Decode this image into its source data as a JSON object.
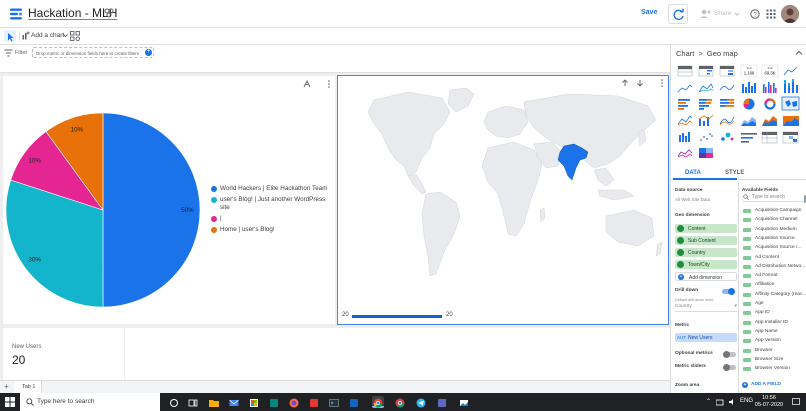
{
  "header": {
    "title": "Hackation - MLH",
    "save_label": "Save",
    "share_label": "Share"
  },
  "toolbar": {
    "add_chart_label": "Add a chart"
  },
  "filter_bar": {
    "label": "Filter",
    "drop_hint": "Drop metric or dimension fields here to create filters"
  },
  "pie_chart": {
    "chart_data": {
      "type": "pie",
      "slices": [
        {
          "label": "World Hackers | Elite Hackathon Team",
          "value": 50,
          "display": "50%",
          "color": "#1a73e8"
        },
        {
          "label": "user's Blog! | Just another WordPress site",
          "value": 30,
          "display": "30%",
          "color": "#12b5cb"
        },
        {
          "label": "|",
          "value": 10,
          "display": "10%",
          "color": "#e52592"
        },
        {
          "label": "Home | user's Blog!",
          "value": 10,
          "display": "10%",
          "color": "#e8710a"
        }
      ]
    }
  },
  "geo_map": {
    "highlighted_region": "India",
    "range_min": "20",
    "range_max": "20",
    "highlight_color": "#1a73e8"
  },
  "scorecard": {
    "label": "New Users",
    "value": "20"
  },
  "pages": [
    {
      "label": "Tab 1"
    }
  ],
  "panel": {
    "breadcrumb_root": "Chart",
    "breadcrumb_sep": ">",
    "breadcrumb_current": "Geo map",
    "tabs": [
      "DATA",
      "STYLE"
    ],
    "scorecard_thumb_values": [
      "1,168",
      "69.3K"
    ],
    "data_source_label": "Data source",
    "data_source_value": "All Web Site Data",
    "geo_dimension_label": "Geo dimension",
    "geo_dimensions": [
      "Content",
      "Sub Content",
      "Country",
      "Town/City"
    ],
    "add_dimension_label": "Add dimension",
    "drill_down_label": "Drill down",
    "drill_down_sub": "Default drill down level",
    "drill_down_value": "Country",
    "metric_label": "Metric",
    "metric_tag": "AUT",
    "metric_value": "New Users",
    "optional_metrics_label": "Optional metrics",
    "metric_sliders_label": "Metric sliders",
    "zoom_area_label": "Zoom area",
    "available_fields_label": "Available Fields",
    "search_placeholder": "Type to search",
    "fields": [
      "Acquisition Campaign",
      "Acquisition Channel",
      "Acquisition Medium",
      "Acquisition Source",
      "Acquisition Source /...",
      "Ad Content",
      "Ad Distribution Netwo...",
      "Ad Format",
      "Affiliation",
      "Affinity Category (reac...",
      "Age",
      "App ID",
      "App Installer ID",
      "App Name",
      "App Version",
      "Browser",
      "Browser Size",
      "Browser Version"
    ],
    "add_field_label": "ADD A FIELD"
  },
  "taskbar": {
    "search_placeholder": "Type here to search",
    "language": "ENG",
    "time": "10:56",
    "date": "05-07-2020"
  }
}
